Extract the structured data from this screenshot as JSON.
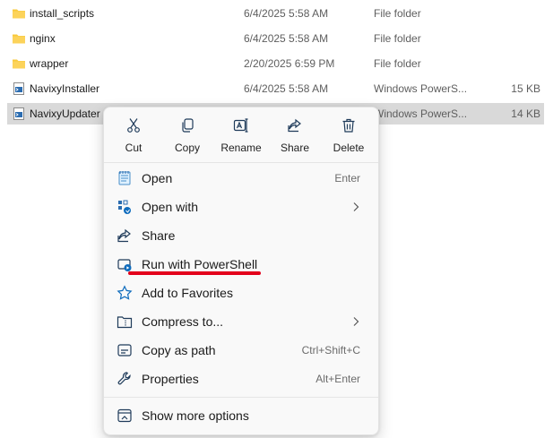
{
  "files": [
    {
      "name": "install_scripts",
      "date": "6/4/2025 5:58 AM",
      "type": "File folder",
      "size": "",
      "icon": "folder-icon"
    },
    {
      "name": "nginx",
      "date": "6/4/2025 5:58 AM",
      "type": "File folder",
      "size": "",
      "icon": "folder-icon"
    },
    {
      "name": "wrapper",
      "date": "2/20/2025 6:59 PM",
      "type": "File folder",
      "size": "",
      "icon": "folder-icon"
    },
    {
      "name": "NavixyInstaller",
      "date": "6/4/2025 5:58 AM",
      "type": "Windows PowerS...",
      "size": "15 KB",
      "icon": "powershell-script-icon"
    },
    {
      "name": "NavixyUpdater",
      "date": "",
      "type": "Windows PowerS...",
      "size": "14 KB",
      "icon": "powershell-script-icon",
      "selected": true
    }
  ],
  "context_menu": {
    "actions": [
      {
        "label": "Cut",
        "icon": "cut-icon"
      },
      {
        "label": "Copy",
        "icon": "copy-icon"
      },
      {
        "label": "Rename",
        "icon": "rename-icon"
      },
      {
        "label": "Share",
        "icon": "share-icon"
      },
      {
        "label": "Delete",
        "icon": "delete-icon"
      }
    ],
    "items": [
      {
        "label": "Open",
        "shortcut": "Enter",
        "icon": "open-notepad-icon"
      },
      {
        "label": "Open with",
        "submenu": true,
        "icon": "open-with-icon"
      },
      {
        "label": "Share",
        "icon": "share-icon"
      },
      {
        "label": "Run with PowerShell",
        "icon": "powershell-run-icon",
        "highlighted_annotation": true
      },
      {
        "label": "Add to Favorites",
        "icon": "star-icon"
      },
      {
        "label": "Compress to...",
        "submenu": true,
        "icon": "compress-folder-icon"
      },
      {
        "label": "Copy as path",
        "shortcut": "Ctrl+Shift+C",
        "icon": "copy-path-icon"
      },
      {
        "label": "Properties",
        "shortcut": "Alt+Enter",
        "icon": "wrench-icon"
      }
    ],
    "footer": {
      "label": "Show more options",
      "icon": "show-more-options-icon"
    }
  },
  "colors": {
    "folder": "#f8c93a",
    "accent": "#0f6cbd",
    "annotation_underline": "#e3001b",
    "selection": "#d9d9d9"
  }
}
